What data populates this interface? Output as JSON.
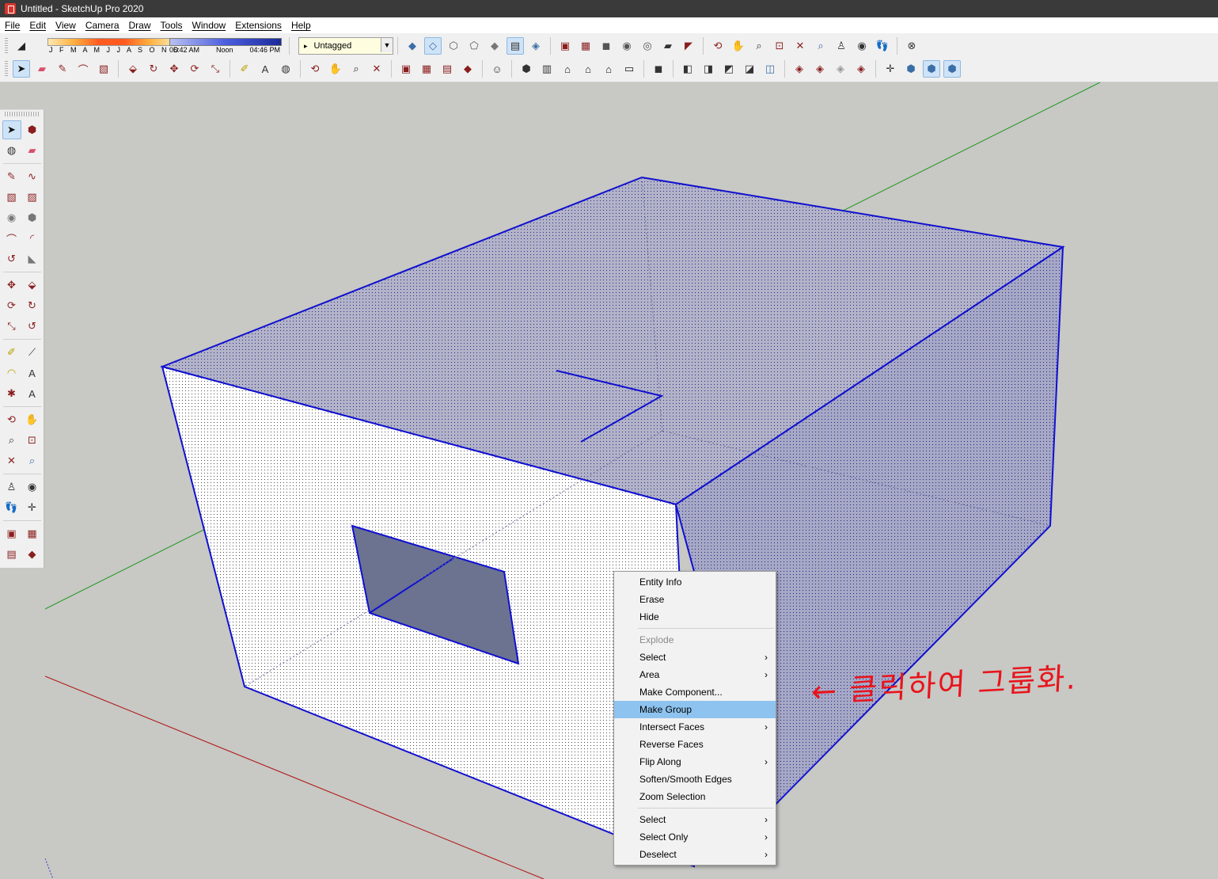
{
  "window": {
    "title": "Untitled - SketchUp Pro 2020"
  },
  "menubar": {
    "items": [
      "File",
      "Edit",
      "View",
      "Camera",
      "Draw",
      "Tools",
      "Window",
      "Extensions",
      "Help"
    ]
  },
  "toolbar": {
    "shadow_months": "J F M A M J J A S O N D",
    "time_start": "06:42 AM",
    "time_mid": "Noon",
    "time_end": "04:46 PM",
    "tag_value": "Untagged"
  },
  "context_menu": {
    "items": [
      {
        "label": "Entity Info"
      },
      {
        "label": "Erase"
      },
      {
        "label": "Hide"
      },
      {
        "label": "Explode"
      },
      {
        "label": "Select"
      },
      {
        "label": "Area"
      },
      {
        "label": "Make Component..."
      },
      {
        "label": "Make Group"
      },
      {
        "label": "Intersect Faces"
      },
      {
        "label": "Reverse Faces"
      },
      {
        "label": "Flip Along"
      },
      {
        "label": "Soften/Smooth Edges"
      },
      {
        "label": "Zoom Selection"
      },
      {
        "label": "Select"
      },
      {
        "label": "Select Only"
      },
      {
        "label": "Deselect"
      }
    ],
    "highlighted": "Make Group",
    "disabled": [
      "Explode"
    ],
    "highlight_color": "#8ec3ef"
  },
  "annotation": {
    "text": "← 클릭하여 그룹화.",
    "color": "#e8141c"
  },
  "colors": {
    "selection_edge": "#1010d0",
    "viewport_bg": "#c8c8c4",
    "axis_green": "#1a9a1a",
    "axis_red": "#b01010"
  }
}
